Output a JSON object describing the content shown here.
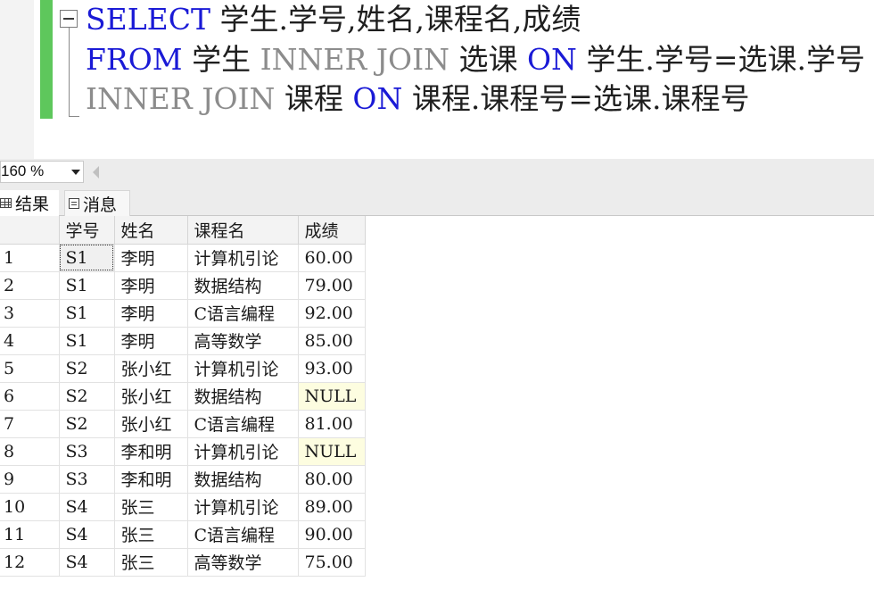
{
  "editor": {
    "line1": {
      "kw": "SELECT",
      "rest": " 学生.学号,姓名,课程名,成绩"
    },
    "line2": {
      "kw1": "FROM",
      "t1": " 学生 ",
      "kw2": "INNER JOIN",
      "t2": " 选课 ",
      "kw3": "ON",
      "t3": " 学生.学号=选课.学号"
    },
    "line3": {
      "kw1": "INNER JOIN",
      "t1": " 课程 ",
      "kw2": "ON",
      "t2": " 课程.课程号=选课.课程号"
    }
  },
  "zoom": {
    "value": "160 %"
  },
  "tabs": {
    "results": "结果",
    "messages": "消息"
  },
  "grid": {
    "columns": [
      "学号",
      "姓名",
      "课程名",
      "成绩"
    ],
    "rows": [
      {
        "n": "1",
        "sno": "S1",
        "name": "李明",
        "course": "计算机引论",
        "score": "60.00"
      },
      {
        "n": "2",
        "sno": "S1",
        "name": "李明",
        "course": "数据结构",
        "score": "79.00"
      },
      {
        "n": "3",
        "sno": "S1",
        "name": "李明",
        "course": "C语言编程",
        "score": "92.00"
      },
      {
        "n": "4",
        "sno": "S1",
        "name": "李明",
        "course": "高等数学",
        "score": "85.00"
      },
      {
        "n": "5",
        "sno": "S2",
        "name": "张小红",
        "course": "计算机引论",
        "score": "93.00"
      },
      {
        "n": "6",
        "sno": "S2",
        "name": "张小红",
        "course": "数据结构",
        "score": "NULL"
      },
      {
        "n": "7",
        "sno": "S2",
        "name": "张小红",
        "course": "C语言编程",
        "score": "81.00"
      },
      {
        "n": "8",
        "sno": "S3",
        "name": "李和明",
        "course": "计算机引论",
        "score": "NULL"
      },
      {
        "n": "9",
        "sno": "S3",
        "name": "李和明",
        "course": "数据结构",
        "score": "80.00"
      },
      {
        "n": "10",
        "sno": "S4",
        "name": "张三",
        "course": "计算机引论",
        "score": "89.00"
      },
      {
        "n": "11",
        "sno": "S4",
        "name": "张三",
        "course": "C语言编程",
        "score": "90.00"
      },
      {
        "n": "12",
        "sno": "S4",
        "name": "张三",
        "course": "高等数学",
        "score": "75.00"
      }
    ]
  },
  "colors": {
    "keyword": "#1a1ad6",
    "keyword_gray": "#8c8c8c",
    "change_bar": "#5ec75c",
    "null_cell": "#fdfde0"
  }
}
